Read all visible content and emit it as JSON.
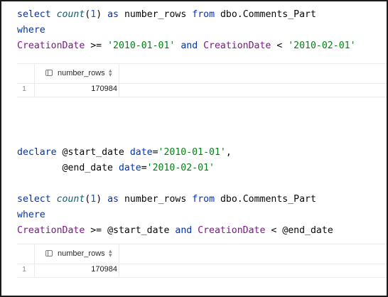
{
  "query1": {
    "line1": {
      "kw1": "select",
      "fn": "count",
      "p1": "(",
      "num": "1",
      "p2": ")",
      "kw2": "as",
      "col": "number_rows",
      "kw3": "from",
      "table": "dbo.Comments_Part"
    },
    "line2": {
      "kw": "where"
    },
    "line3": {
      "col1": "CreationDate",
      "op1": ">=",
      "str1": "'2010-01-01'",
      "kw": "and",
      "col2": "CreationDate",
      "op2": "<",
      "str2": "'2010-02-01'"
    }
  },
  "result1": {
    "column_header": "number_rows",
    "rows": [
      {
        "row_number": "1",
        "value": "170984"
      }
    ]
  },
  "declare_block": {
    "line1": {
      "kw": "declare",
      "var": "@start_date",
      "type": "date",
      "eq": "=",
      "str": "'2010-01-01'",
      "comma": ","
    },
    "line2": {
      "var": "@end_date",
      "type": "date",
      "eq": "=",
      "str": "'2010-02-01'"
    }
  },
  "query2": {
    "line1": {
      "kw1": "select",
      "fn": "count",
      "p1": "(",
      "num": "1",
      "p2": ")",
      "kw2": "as",
      "col": "number_rows",
      "kw3": "from",
      "table": "dbo.Comments_Part"
    },
    "line2": {
      "kw": "where"
    },
    "line3": {
      "col1": "CreationDate",
      "op1": ">=",
      "var1": "@start_date",
      "kw": "and",
      "col2": "CreationDate",
      "op2": "<",
      "var2": "@end_date"
    }
  },
  "result2": {
    "column_header": "number_rows",
    "rows": [
      {
        "row_number": "1",
        "value": "170984"
      }
    ]
  },
  "colors": {
    "keyword": "#0033b3",
    "function": "#00627a",
    "number": "#1750eb",
    "string": "#067d17",
    "column": "#871094"
  },
  "icons": {
    "column_icon": "table-column-icon",
    "sort_icon": "sort-arrows-icon"
  }
}
